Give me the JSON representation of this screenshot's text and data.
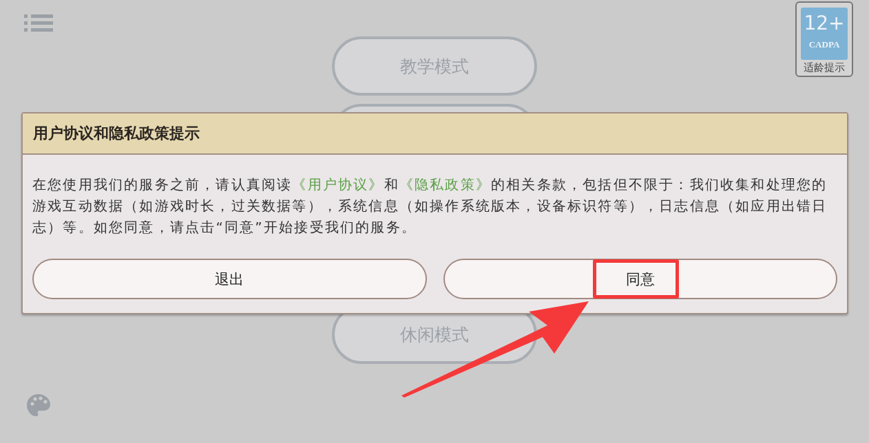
{
  "mode_buttons": [
    {
      "label": "教学模式"
    },
    {
      "label": "休闲模式"
    }
  ],
  "age_rating": {
    "rating": "12+",
    "org": "CADPA",
    "caption": "适龄提示"
  },
  "dialog": {
    "title": "用户协议和隐私政策提示",
    "body": [
      {
        "kind": "text",
        "text": "在您使用我们的服务之前，请认真阅读"
      },
      {
        "kind": "link",
        "text": "《用户协议》"
      },
      {
        "kind": "text",
        "text": "和"
      },
      {
        "kind": "link",
        "text": "《隐私政策》"
      },
      {
        "kind": "text",
        "text": "的相关条款，包括但不限于：我们收集和处理您的游戏互动数据（如游戏时长，过关数据等），系统信息（如操作系统版本，设备标识符等），日志信息（如应用出错日志）等。如您同意，请点击“同意”开始接受我们的服务。"
      }
    ],
    "buttons": [
      {
        "label": "退出",
        "highlighted": false
      },
      {
        "label": "同意",
        "highlighted": true
      }
    ]
  }
}
